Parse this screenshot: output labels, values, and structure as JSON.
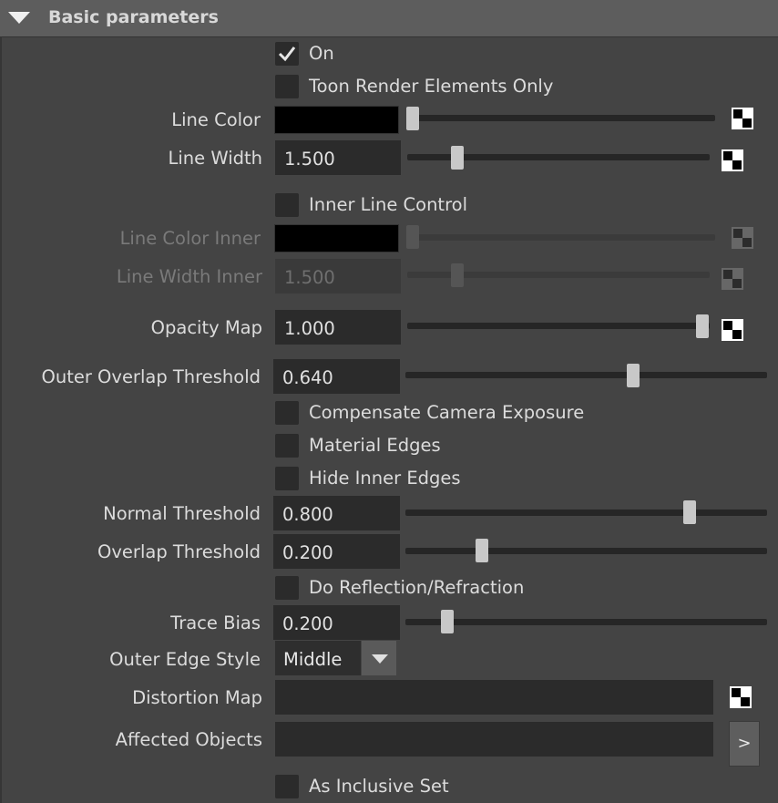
{
  "section": {
    "title": "Basic parameters"
  },
  "checkboxes": {
    "on": {
      "label": "On",
      "checked": true
    },
    "toon_render_elements_only": {
      "label": "Toon Render Elements Only",
      "checked": false
    },
    "inner_line_control": {
      "label": "Inner Line Control",
      "checked": false
    },
    "compensate_camera_exposure": {
      "label": "Compensate Camera Exposure",
      "checked": false
    },
    "material_edges": {
      "label": "Material Edges",
      "checked": false
    },
    "hide_inner_edges": {
      "label": "Hide Inner Edges",
      "checked": false
    },
    "do_reflection_refraction": {
      "label": "Do Reflection/Refraction",
      "checked": false
    },
    "as_inclusive_set": {
      "label": "As Inclusive Set",
      "checked": false
    }
  },
  "line_color": {
    "label": "Line Color",
    "color": "#000000",
    "slider": 0.0
  },
  "line_width": {
    "label": "Line Width",
    "value": "1.500",
    "slider": 0.15
  },
  "line_color_inner": {
    "label": "Line Color Inner",
    "color": "#000000",
    "slider": 0.0,
    "disabled": true
  },
  "line_width_inner": {
    "label": "Line Width Inner",
    "value": "1.500",
    "slider": 0.15,
    "disabled": true
  },
  "opacity_map": {
    "label": "Opacity Map",
    "value": "1.000",
    "slider": 1.0
  },
  "outer_overlap_threshold": {
    "label": "Outer Overlap Threshold",
    "value": "0.640",
    "slider": 0.64
  },
  "normal_threshold": {
    "label": "Normal Threshold",
    "value": "0.800",
    "slider": 0.8
  },
  "overlap_threshold": {
    "label": "Overlap Threshold",
    "value": "0.200",
    "slider": 0.2
  },
  "trace_bias": {
    "label": "Trace Bias",
    "value": "0.200",
    "slider": 0.1
  },
  "outer_edge_style": {
    "label": "Outer Edge Style",
    "selected": "Middle"
  },
  "distortion_map": {
    "label": "Distortion Map",
    "value": ""
  },
  "affected_objects": {
    "label": "Affected Objects",
    "value": "",
    "button_label": ">"
  },
  "icons": {
    "collapse": "triangle-down-icon",
    "checkmark": "checkmark-icon",
    "map": "checker-map-icon",
    "dropdown": "chevron-down-icon"
  }
}
